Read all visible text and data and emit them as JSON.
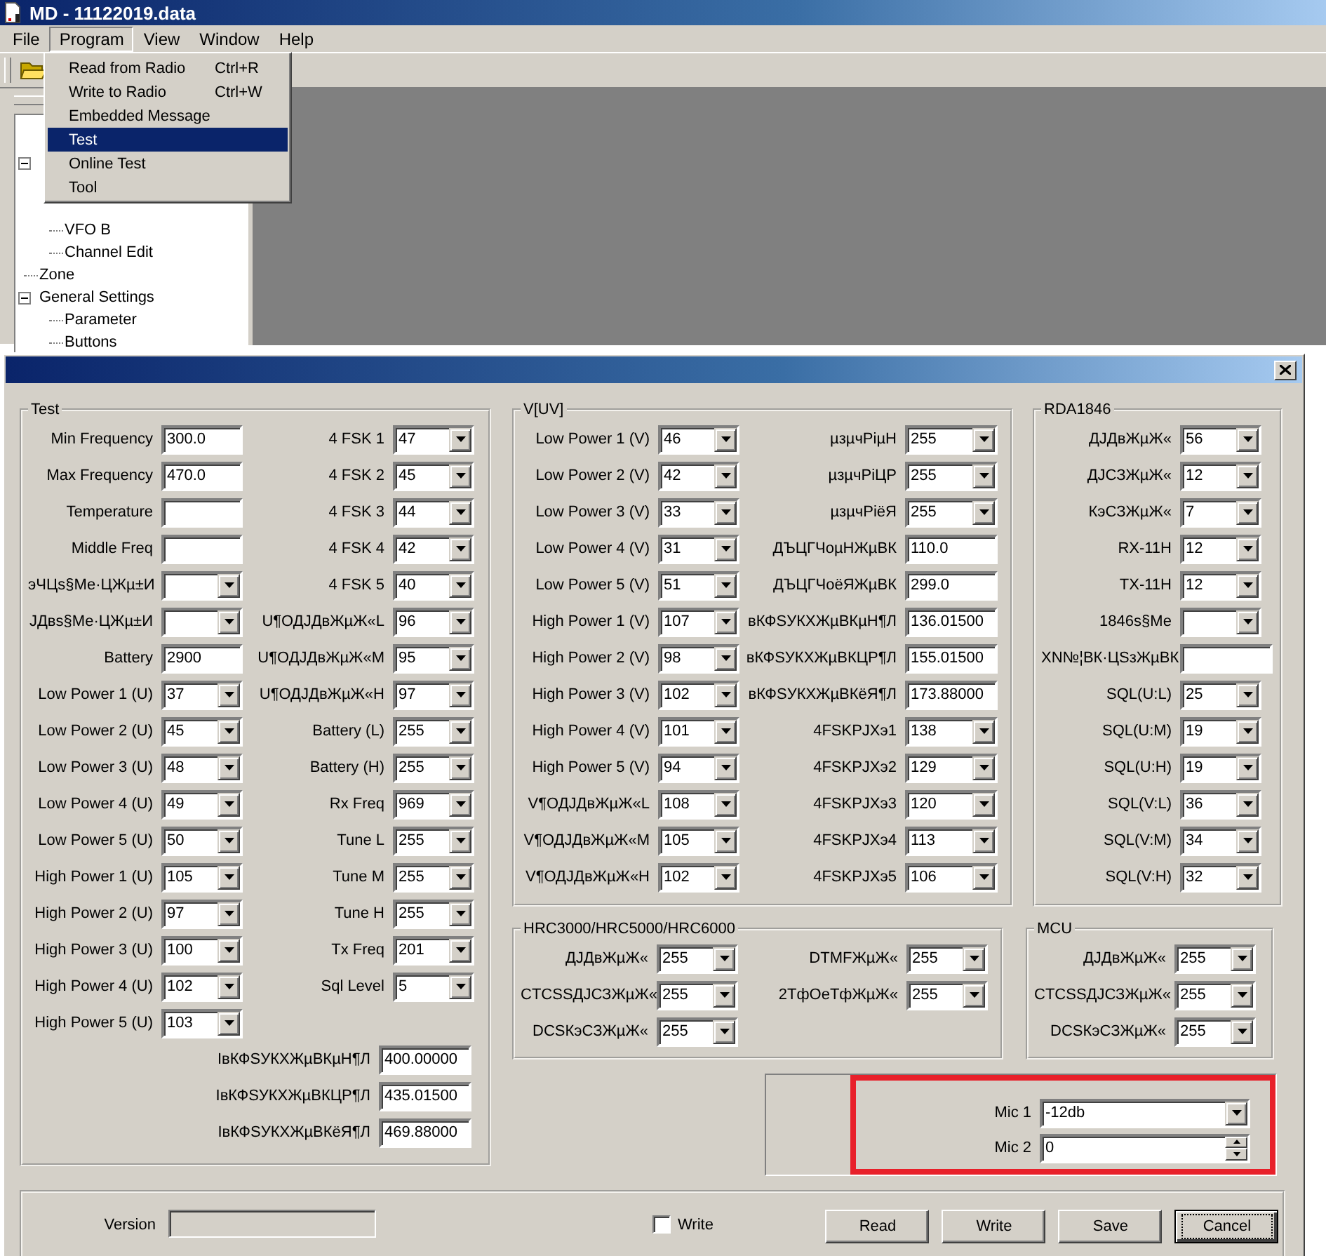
{
  "app": {
    "title": "MD - 11122019.data",
    "menu": [
      {
        "label": "File",
        "selected": false
      },
      {
        "label": "Program",
        "selected": true
      },
      {
        "label": "View",
        "selected": false
      },
      {
        "label": "Window",
        "selected": false
      },
      {
        "label": "Help",
        "selected": false
      }
    ],
    "dropdown": [
      {
        "label": "Read from Radio",
        "shortcut": "Ctrl+R",
        "selected": false
      },
      {
        "label": "Write to Radio",
        "shortcut": "Ctrl+W",
        "selected": false
      },
      {
        "label": "Embedded Message",
        "selected": false
      },
      {
        "label": "Test",
        "selected": true
      },
      {
        "label": "Online Test",
        "selected": false
      },
      {
        "label": "Tool",
        "selected": false
      }
    ],
    "tree": [
      {
        "expanded": true,
        "children": [
          {
            "label": "VFO B"
          },
          {
            "label": "Channel Edit"
          }
        ]
      },
      {
        "label": "Zone"
      },
      {
        "label": "General Settings",
        "expanded": true,
        "children": [
          {
            "label": "Parameter"
          },
          {
            "label": "Buttons"
          }
        ]
      }
    ]
  },
  "dialog": {
    "groups": [
      {
        "title": "Test",
        "columns": [
          {
            "rows": [
              {
                "label": "Min Frequency",
                "kind": "text",
                "value": "300.0"
              },
              {
                "label": "Max Frequency",
                "kind": "text",
                "value": "470.0"
              },
              {
                "label": "Temperature",
                "kind": "text"
              },
              {
                "label": "Middle Freq",
                "kind": "text"
              },
              {
                "label": "эЧЦѕ§Ме·ЦЖµ±И",
                "kind": "combo"
              },
              {
                "label": "ЈДвѕ§Ме·ЦЖµ±И",
                "kind": "combo"
              },
              {
                "label": "Battery",
                "kind": "text",
                "value": "2900"
              },
              {
                "label": "Low Power 1 (U)",
                "kind": "combo",
                "value": "37"
              },
              {
                "label": "Low Power 2 (U)",
                "kind": "combo",
                "value": "45"
              },
              {
                "label": "Low Power 3 (U)",
                "kind": "combo",
                "value": "48"
              },
              {
                "label": "Low Power 4 (U)",
                "kind": "combo",
                "value": "49"
              },
              {
                "label": "Low Power 5 (U)",
                "kind": "combo",
                "value": "50"
              },
              {
                "label": "High Power 1 (U)",
                "kind": "combo",
                "value": "105"
              },
              {
                "label": "High Power 2 (U)",
                "kind": "combo",
                "value": "97"
              },
              {
                "label": "High Power 3 (U)",
                "kind": "combo",
                "value": "100"
              },
              {
                "label": "High Power 4 (U)",
                "kind": "combo",
                "value": "102"
              },
              {
                "label": "High Power 5 (U)",
                "kind": "combo",
                "value": "103"
              }
            ]
          },
          {
            "rows": [
              {
                "label": "4 FSK 1",
                "kind": "combo",
                "value": "47"
              },
              {
                "label": "4 FSK 2",
                "kind": "combo",
                "value": "45"
              },
              {
                "label": "4 FSK 3",
                "kind": "combo",
                "value": "44"
              },
              {
                "label": "4 FSK 4",
                "kind": "combo",
                "value": "42"
              },
              {
                "label": "4 FSK 5",
                "kind": "combo",
                "value": "40"
              },
              {
                "label": "U¶ОДЈДвЖµЖ«L",
                "kind": "combo",
                "value": "96"
              },
              {
                "label": "U¶ОДЈДвЖµЖ«M",
                "kind": "combo",
                "value": "95"
              },
              {
                "label": "U¶ОДЈДвЖµЖ«H",
                "kind": "combo",
                "value": "97"
              },
              {
                "label": "Battery (L)",
                "kind": "combo",
                "value": "255"
              },
              {
                "label": "Battery (H)",
                "kind": "combo",
                "value": "255"
              },
              {
                "label": "Rx Freq",
                "kind": "combo",
                "value": "969"
              },
              {
                "label": "Tune L",
                "kind": "combo",
                "value": "255"
              },
              {
                "label": "Tune M",
                "kind": "combo",
                "value": "255"
              },
              {
                "label": "Tune H",
                "kind": "combo",
                "value": "255"
              },
              {
                "label": "Tx Freq",
                "kind": "combo",
                "value": "201"
              },
              {
                "label": "Sql Level",
                "kind": "combo",
                "value": "5"
              }
            ]
          },
          {
            "rows": [
              {
                "label": "ІвКФЅУКХЖµВКµН¶Л",
                "kind": "text",
                "value": "400.00000"
              },
              {
                "label": "ІвКФЅУКХЖµВКЦР¶Л",
                "kind": "text",
                "value": "435.01500"
              },
              {
                "label": "ІвКФЅУКХЖµВКёЯ¶Л",
                "kind": "text",
                "value": "469.88000"
              }
            ]
          }
        ]
      },
      {
        "title": "V[UV]",
        "columns": [
          {
            "rows": [
              {
                "label": "Low Power 1 (V)",
                "kind": "combo",
                "value": "46"
              },
              {
                "label": "Low Power 2 (V)",
                "kind": "combo",
                "value": "42"
              },
              {
                "label": "Low Power 3 (V)",
                "kind": "combo",
                "value": "33"
              },
              {
                "label": "Low Power 4 (V)",
                "kind": "combo",
                "value": "31"
              },
              {
                "label": "Low Power 5 (V)",
                "kind": "combo",
                "value": "51"
              },
              {
                "label": "High Power 1 (V)",
                "kind": "combo",
                "value": "107"
              },
              {
                "label": "High Power 2 (V)",
                "kind": "combo",
                "value": "98"
              },
              {
                "label": "High Power 3 (V)",
                "kind": "combo",
                "value": "102"
              },
              {
                "label": "High Power 4 (V)",
                "kind": "combo",
                "value": "101"
              },
              {
                "label": "High Power 5 (V)",
                "kind": "combo",
                "value": "94"
              },
              {
                "label": "V¶ОДЈДвЖµЖ«L",
                "kind": "combo",
                "value": "108"
              },
              {
                "label": "V¶ОДЈДвЖµЖ«M",
                "kind": "combo",
                "value": "105"
              },
              {
                "label": "V¶ОДЈДвЖµЖ«H",
                "kind": "combo",
                "value": "102"
              }
            ]
          },
          {
            "rows": [
              {
                "label": "µзµчРіµН",
                "kind": "combo",
                "value": "255"
              },
              {
                "label": "µзµчРіЦР",
                "kind": "combo",
                "value": "255"
              },
              {
                "label": "µзµчРіёЯ",
                "kind": "combo",
                "value": "255"
              },
              {
                "label": "ДЪЦГЧоµНЖµВК",
                "kind": "text",
                "value": "110.0"
              },
              {
                "label": "ДЪЦГЧоёЯЖµВК",
                "kind": "text",
                "value": "299.0"
              },
              {
                "label": "вКФЅУКХЖµВКµН¶Л",
                "kind": "text",
                "value": "136.01500"
              },
              {
                "label": "вКФЅУКХЖµВКЦР¶Л",
                "kind": "text",
                "value": "155.01500"
              },
              {
                "label": "вКФЅУКХЖµВКёЯ¶Л",
                "kind": "text",
                "value": "173.88000"
              },
              {
                "label": "4FSKРЈХэ1",
                "kind": "combo",
                "value": "138"
              },
              {
                "label": "4FSKРЈХэ2",
                "kind": "combo",
                "value": "129"
              },
              {
                "label": "4FSKРЈХэ3",
                "kind": "combo",
                "value": "120"
              },
              {
                "label": "4FSKРЈХэ4",
                "kind": "combo",
                "value": "113"
              },
              {
                "label": "4FSKРЈХэ5",
                "kind": "combo",
                "value": "106"
              }
            ]
          }
        ]
      },
      {
        "title": "RDA1846",
        "columns": [
          {
            "rows": [
              {
                "label": "ДЈДвЖµЖ«",
                "kind": "combo",
                "value": "56"
              },
              {
                "label": "ДЈСЗЖµЖ«",
                "kind": "combo",
                "value": "12"
              },
              {
                "label": "КэСЗЖµЖ«",
                "kind": "combo",
                "value": "7"
              },
              {
                "label": "RX-11H",
                "kind": "combo",
                "value": "12"
              },
              {
                "label": "TX-11H",
                "kind": "combo",
                "value": "12"
              },
              {
                "label": "1846ѕ§Ме",
                "kind": "combo"
              },
              {
                "label": "ХN№¦ВК·ЦЅзЖµВК",
                "kind": "text"
              },
              {
                "label": "SQL(U:L)",
                "kind": "combo",
                "value": "25"
              },
              {
                "label": "SQL(U:M)",
                "kind": "combo",
                "value": "19"
              },
              {
                "label": "SQL(U:H)",
                "kind": "combo",
                "value": "19"
              },
              {
                "label": "SQL(V:L)",
                "kind": "combo",
                "value": "36"
              },
              {
                "label": "SQL(V:M)",
                "kind": "combo",
                "value": "34"
              },
              {
                "label": "SQL(V:H)",
                "kind": "combo",
                "value": "32"
              }
            ]
          }
        ]
      },
      {
        "title": "HRC3000/HRC5000/HRC6000",
        "columns": [
          {
            "rows": [
              {
                "label": "ДЈДвЖµЖ«",
                "kind": "combo",
                "value": "255"
              },
              {
                "label": "CTCSSДЈСЗЖµЖ«",
                "kind": "combo",
                "value": "255"
              },
              {
                "label": "DCSКэСЗЖµЖ«",
                "kind": "combo",
                "value": "255"
              }
            ]
          },
          {
            "rows": [
              {
                "label": "DTMFЖµЖ«",
                "kind": "combo",
                "value": "255"
              },
              {
                "label": "2ТфОеТфЖµЖ«",
                "kind": "combo",
                "value": "255"
              }
            ]
          }
        ]
      },
      {
        "title": "MCU",
        "columns": [
          {
            "rows": [
              {
                "label": "ДЈДвЖµЖ«",
                "kind": "combo",
                "value": "255"
              },
              {
                "label": "CTCSSДЈСЗЖµЖ«",
                "kind": "combo",
                "value": "255"
              },
              {
                "label": "DCSКэСЗЖµЖ«",
                "kind": "combo",
                "value": "255"
              }
            ]
          }
        ]
      }
    ],
    "mic": [
      {
        "label": "Mic 1",
        "kind": "combo",
        "value": "-12db"
      },
      {
        "label": "Mic 2",
        "kind": "spin",
        "value": "0"
      }
    ],
    "footer": {
      "version_label": "Version",
      "write_checkbox": {
        "label": "Write",
        "checked": false
      },
      "buttons": [
        {
          "label": "Read",
          "default": false
        },
        {
          "label": "Write",
          "default": false
        },
        {
          "label": "Save",
          "default": false
        },
        {
          "label": "Cancel",
          "default": true
        }
      ]
    }
  }
}
